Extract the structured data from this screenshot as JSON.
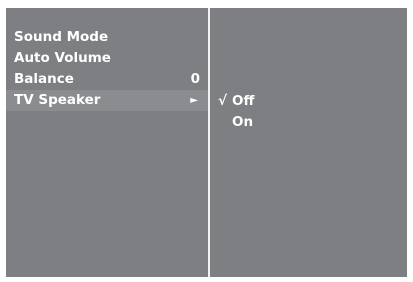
{
  "menu": {
    "items": [
      {
        "label": "Sound Mode",
        "value": ""
      },
      {
        "label": "Auto Volume",
        "value": ""
      },
      {
        "label": "Balance",
        "value": "0"
      },
      {
        "label": "TV Speaker",
        "value": "",
        "arrow": "►"
      }
    ]
  },
  "submenu": {
    "check_glyph": "√",
    "options": [
      {
        "label": "Off",
        "selected": true
      },
      {
        "label": "On",
        "selected": false
      }
    ]
  },
  "colors": {
    "panel": "#7e7f82",
    "highlight": "#8b8c8f",
    "divider": "#f2f2f2",
    "text": "#ffffff"
  }
}
